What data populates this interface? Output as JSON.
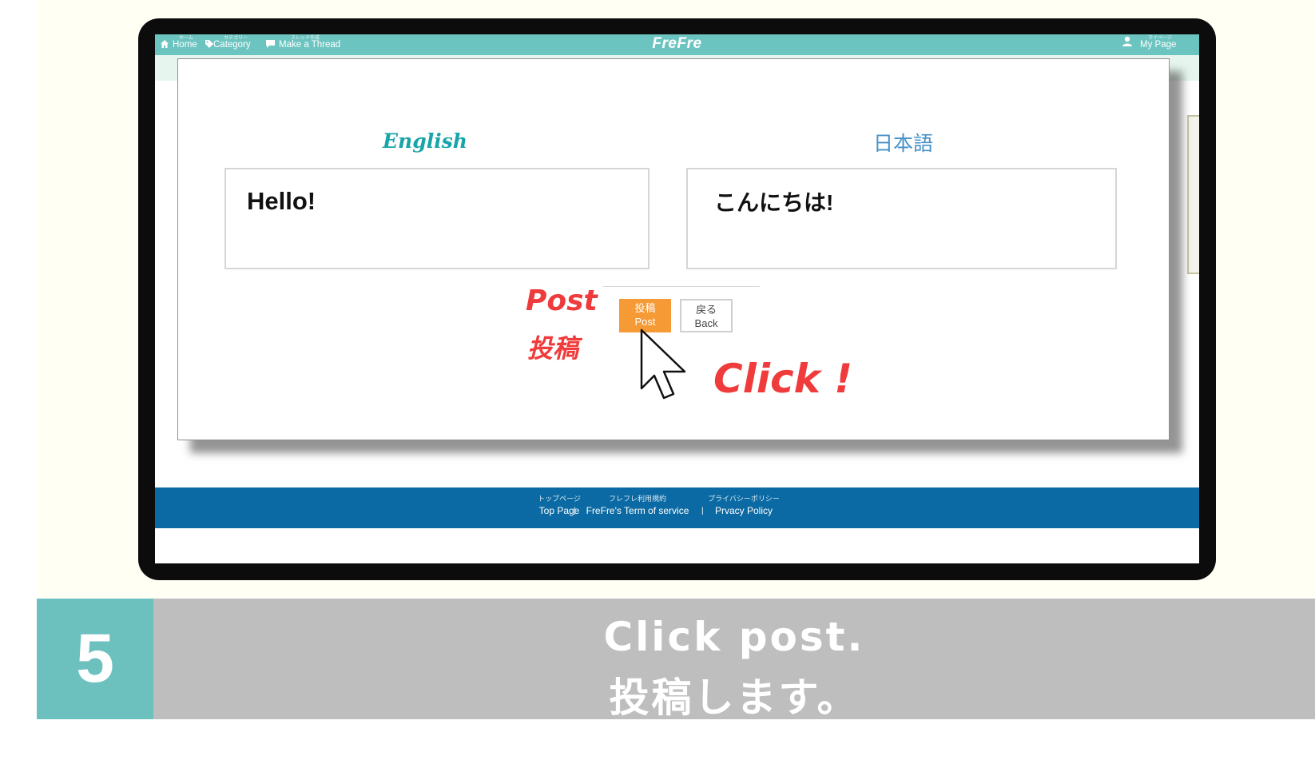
{
  "navbar": {
    "home_sub": "ホーム",
    "home_label": "Home",
    "category_sub": "カテゴリー",
    "category_label": "Category",
    "thread_sub": "スレッド作成",
    "thread_label": "Make a Thread",
    "brand": "FreFre",
    "mypage_sub": "マイページ",
    "mypage_label": "My Page"
  },
  "form": {
    "english_heading": "English",
    "japanese_heading": "日本語",
    "english_text": "Hello!",
    "japanese_text": "こんにちは!",
    "post_button_jp": "投稿",
    "post_button_en": "Post",
    "back_button_jp": "戻る",
    "back_button_en": "Back"
  },
  "footer": {
    "links": [
      {
        "sub": "トップページ",
        "label": "Top Page"
      },
      {
        "sub": "フレフレ利用規約",
        "label": "FreFre's Term of service"
      },
      {
        "sub": "プライバシーポリシー",
        "label": "Prvacy Policy"
      }
    ],
    "separator": "|"
  },
  "annotations": {
    "post_en": "Post",
    "post_jp": "投稿",
    "click": "Click !"
  },
  "caption": {
    "step_number": "5",
    "line1": "Click post.",
    "line2": "投稿します。"
  },
  "colors": {
    "accent_teal": "#6cc4c0",
    "post_button": "#f59a34",
    "footer_blue": "#0b6aa3",
    "annotation_red": "#ef3b3b"
  }
}
